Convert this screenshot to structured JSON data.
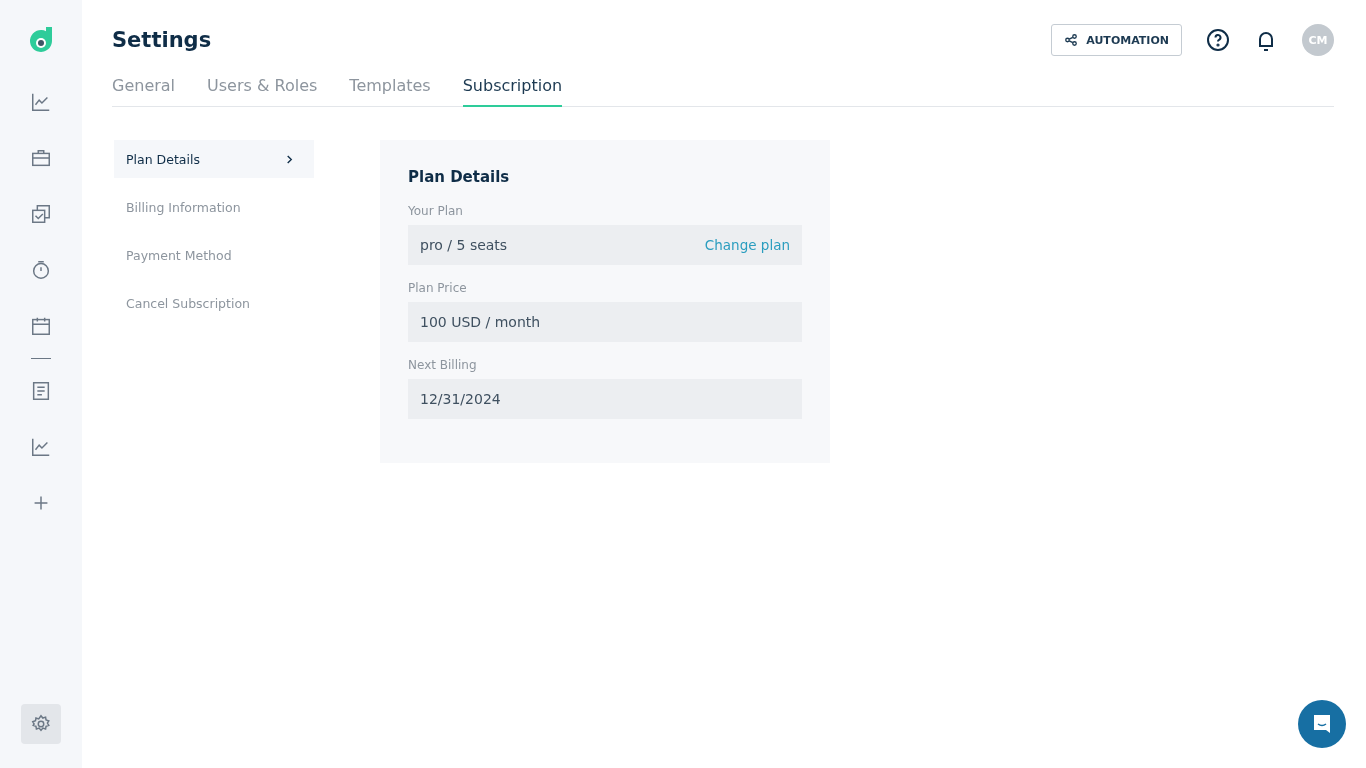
{
  "sidebar": {
    "items": [
      {
        "selected": false
      },
      {
        "selected": false
      },
      {
        "selected": false
      },
      {
        "selected": false
      },
      {
        "selected": false
      },
      {
        "selected": false
      },
      {
        "selected": false
      },
      {
        "selected": false
      }
    ],
    "settings": {
      "selected": true
    }
  },
  "header": {
    "title": "Settings",
    "automation_button": "AUTOMATION",
    "avatar": "CM"
  },
  "tabs": [
    {
      "label": "General",
      "selected": false
    },
    {
      "label": "Users & Roles",
      "selected": false
    },
    {
      "label": "Templates",
      "selected": false
    },
    {
      "label": "Subscription",
      "selected": true
    }
  ],
  "subnav": [
    {
      "label": "Plan Details",
      "selected": true
    },
    {
      "label": "Billing Information",
      "selected": false
    },
    {
      "label": "Payment Method",
      "selected": false
    },
    {
      "label": "Cancel Subscription",
      "selected": false
    }
  ],
  "card": {
    "title": "Plan Details",
    "fields": [
      {
        "label": "Your Plan",
        "value": "pro / 5 seats",
        "action": "Change plan"
      },
      {
        "label": "Plan Price",
        "value": "100 USD / month"
      },
      {
        "label": "Next Billing",
        "value": "12/31/2024"
      }
    ]
  }
}
